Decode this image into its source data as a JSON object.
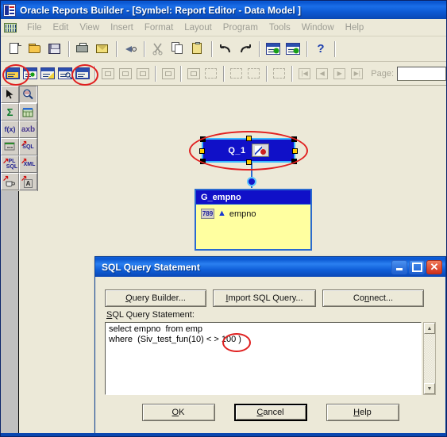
{
  "window": {
    "title": "Oracle Reports Builder  - [Symbel: Report Editor  - Data Model ]",
    "app_icon": "reports-builder-icon"
  },
  "menubar": {
    "icon": "data-model-icon",
    "items": [
      {
        "label": "File"
      },
      {
        "label": "Edit"
      },
      {
        "label": "View"
      },
      {
        "label": "Insert"
      },
      {
        "label": "Format"
      },
      {
        "label": "Layout"
      },
      {
        "label": "Program"
      },
      {
        "label": "Tools"
      },
      {
        "label": "Window"
      },
      {
        "label": "Help"
      }
    ]
  },
  "toolbar_main": {
    "buttons": [
      {
        "name": "new-icon",
        "label": "New"
      },
      {
        "name": "open-icon",
        "label": "Open"
      },
      {
        "name": "save-icon",
        "label": "Save"
      },
      {
        "name": "print-icon",
        "label": "Print"
      },
      {
        "name": "mail-icon",
        "label": "Mail"
      },
      {
        "name": "run-web-icon",
        "label": "Run Web Layout"
      },
      {
        "name": "cut-icon",
        "label": "Cut"
      },
      {
        "name": "copy-icon",
        "label": "Copy"
      },
      {
        "name": "paste-icon",
        "label": "Paste"
      },
      {
        "name": "undo-icon",
        "label": "Undo"
      },
      {
        "name": "redo-icon",
        "label": "Redo"
      },
      {
        "name": "run-paper-icon",
        "label": "Run Paper Layout"
      },
      {
        "name": "run-report-icon",
        "label": "Run Report"
      },
      {
        "name": "help-icon",
        "label": "Help"
      }
    ]
  },
  "toolbar_secondary": {
    "buttons": [
      {
        "name": "data-model-view-icon",
        "label": "Data Model",
        "highlighted": true
      },
      {
        "name": "web-source-view-icon",
        "label": "Web Source"
      },
      {
        "name": "paper-layout-view-icon",
        "label": "Paper Layout"
      },
      {
        "name": "paper-design-view-icon",
        "label": "Paper Design"
      },
      {
        "name": "paper-parameter-form-icon",
        "label": "Paper Parameter Form",
        "highlighted": true
      },
      {
        "name": "group-above-icon",
        "label": "Group Above"
      },
      {
        "name": "group-left-icon",
        "label": "Group Left"
      },
      {
        "name": "form-icon",
        "label": "Form"
      },
      {
        "name": "report-block-icon",
        "label": "Report Block"
      },
      {
        "name": "frame-select-icon",
        "label": "Frame Select"
      },
      {
        "name": "flex-off-icon",
        "label": "Flex Off"
      },
      {
        "name": "confine-mode-icon",
        "label": "Confine Mode"
      },
      {
        "name": "flex-mode-icon",
        "label": "Flex Mode"
      },
      {
        "name": "select-parent-frame-icon",
        "label": "Select Parent Frame"
      }
    ],
    "page_nav": [
      "first-page-icon",
      "previous-page-icon",
      "next-page-icon",
      "last-page-icon"
    ],
    "page_label": "Page:",
    "page_value": ""
  },
  "annotations": {
    "color": "#e02020",
    "circles": [
      {
        "name": "annotation-circle-data-model-tool"
      },
      {
        "name": "annotation-circle-parameter-form-tool"
      },
      {
        "name": "annotation-circle-query-node"
      },
      {
        "name": "annotation-circle-operator"
      }
    ]
  },
  "palette": {
    "tools": [
      {
        "name": "select-tool",
        "glyph": "arrow",
        "selected": false
      },
      {
        "name": "magnify-tool",
        "glyph": "magnify",
        "selected": true
      },
      {
        "name": "summary-column-tool",
        "glyph": "sigma",
        "label": "Σ"
      },
      {
        "name": "data-link-tool",
        "glyph": "table"
      },
      {
        "name": "formula-column-tool",
        "glyph": "fx",
        "label": "f(x)"
      },
      {
        "name": "placeholder-column-tool",
        "glyph": "axb",
        "label": "axb"
      },
      {
        "name": "cross-product-tool",
        "glyph": "dots",
        "label": "···"
      },
      {
        "name": "sql-query-tool",
        "glyph": "sql",
        "label": "SQL"
      },
      {
        "name": "plsql-query-tool",
        "glyph": "plsql",
        "label": "PL SQL"
      },
      {
        "name": "xml-query-tool",
        "glyph": "xml",
        "label": "XML"
      },
      {
        "name": "java-query-tool",
        "glyph": "java"
      },
      {
        "name": "text-query-tool",
        "glyph": "text",
        "label": "A"
      }
    ]
  },
  "data_model": {
    "query_node": {
      "label": "Q_1",
      "badge_icon": "sql-query-badge-icon",
      "selected": true
    },
    "group_node": {
      "title": "G_empno",
      "columns": [
        {
          "type_icon": "number-column-icon",
          "type_label": "789",
          "break_icon": "break-order-up-icon",
          "name": "empno"
        }
      ]
    }
  },
  "dialog": {
    "title": "SQL Query Statement",
    "window_buttons": [
      {
        "name": "minimize-button",
        "label": "_"
      },
      {
        "name": "maximize-button",
        "label": "□"
      },
      {
        "name": "close-button",
        "label": "✕"
      }
    ],
    "top_buttons": [
      {
        "name": "query-builder-button",
        "pre": "",
        "mnemonic": "Q",
        "post": "uery Builder..."
      },
      {
        "name": "import-sql-query-button",
        "pre": "",
        "mnemonic": "I",
        "post": "mport SQL Query..."
      },
      {
        "name": "connect-button",
        "pre": "Co",
        "mnemonic": "n",
        "post": "nect..."
      }
    ],
    "field_label": {
      "pre": "",
      "mnemonic": "S",
      "post": "QL Query Statement:"
    },
    "sql_text": "select empno  from emp\nwhere  (Siv_test_fun(10) < > 100 )",
    "scrollbar": {
      "up": "▲",
      "down": "▼"
    },
    "bottom_buttons": [
      {
        "name": "ok-button",
        "pre": "",
        "mnemonic": "O",
        "post": "K",
        "default": false
      },
      {
        "name": "cancel-button",
        "pre": "",
        "mnemonic": "C",
        "post": "ancel",
        "default": true
      },
      {
        "name": "help-button",
        "pre": "",
        "mnemonic": "H",
        "post": "elp",
        "default": false
      }
    ]
  }
}
